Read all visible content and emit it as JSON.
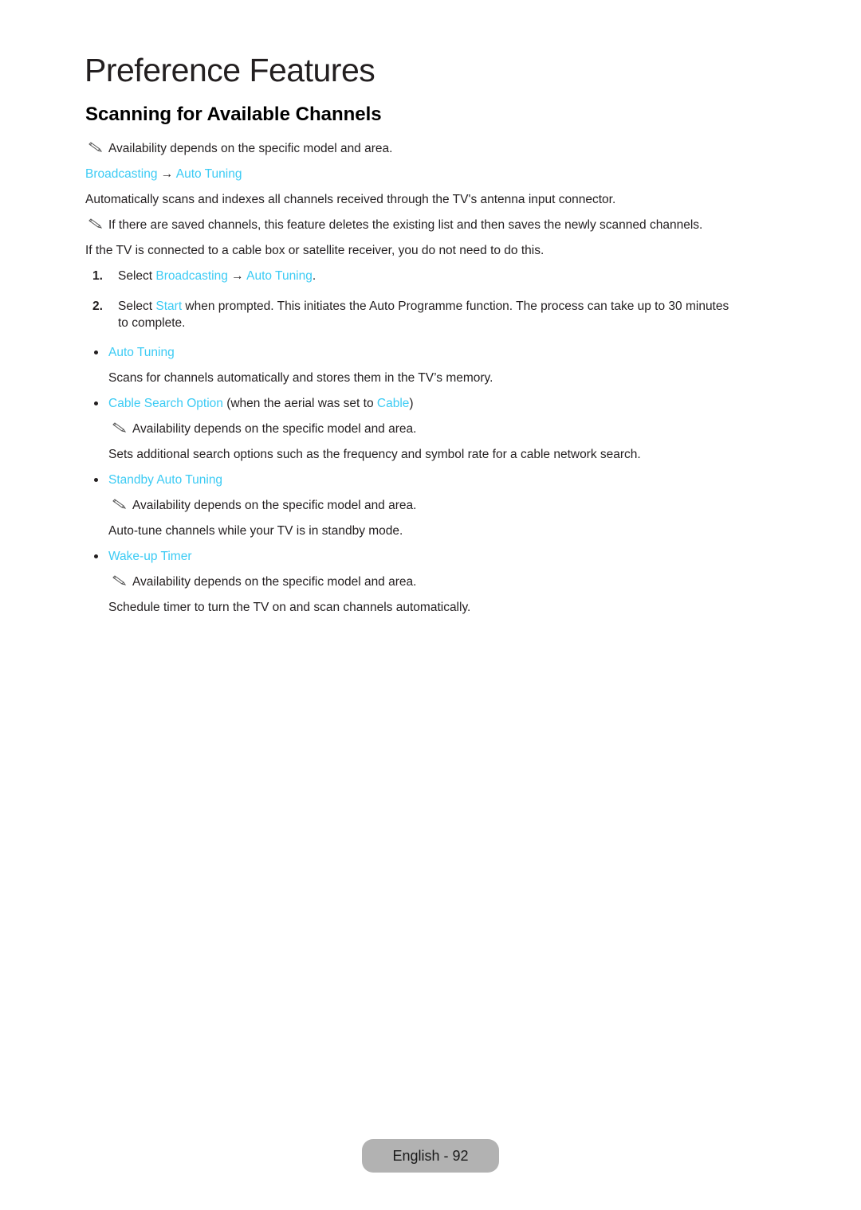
{
  "page": {
    "title": "Preference Features",
    "section_title": "Scanning for Available Channels"
  },
  "colors": {
    "link": "#3ccbf4",
    "text": "#231f20",
    "footer_bg": "#b2b2b2"
  },
  "intro": {
    "note_1": "Availability depends on the specific model and area.",
    "path": {
      "part1": "Broadcasting",
      "arrow": " → ",
      "part2": "Auto Tuning"
    },
    "description": "Automatically scans and indexes all channels received through the TV's antenna input connector.",
    "note_2": "If there are saved channels, this feature deletes the existing list and then saves the newly scanned channels.",
    "cable_box_note": "If the TV is connected to a cable box or satellite receiver, you do not need to do this."
  },
  "steps": [
    {
      "number": "1.",
      "prefix": "Select ",
      "link1": "Broadcasting",
      "arrow": " → ",
      "link2": "Auto Tuning",
      "suffix": "."
    },
    {
      "number": "2.",
      "prefix": "Select ",
      "link": "Start",
      "text_line1": " when prompted. This initiates the Auto Programme function. The process can take up to 30 minutes",
      "text_line2": "to complete."
    }
  ],
  "options": [
    {
      "label": "Auto Tuning",
      "description": "Scans for channels automatically and stores them in the TV’s memory."
    },
    {
      "label": "Cable Search Option",
      "label_suffix_text": " (when the aerial was set to ",
      "label_suffix_link": "Cable",
      "label_suffix_close": ")",
      "note": "Availability depends on the specific model and area.",
      "description": "Sets additional search options such as the frequency and symbol rate for a cable network search."
    },
    {
      "label": "Standby Auto Tuning",
      "note": "Availability depends on the specific model and area.",
      "description": "Auto-tune channels while your TV is in standby mode."
    },
    {
      "label": "Wake-up Timer",
      "note": "Availability depends on the specific model and area.",
      "description": "Schedule timer to turn the TV on and scan channels automatically."
    }
  ],
  "icons": {
    "note": "pencil-note-icon",
    "bullet": "bullet-dot"
  },
  "footer": {
    "page_label": "English - 92"
  }
}
